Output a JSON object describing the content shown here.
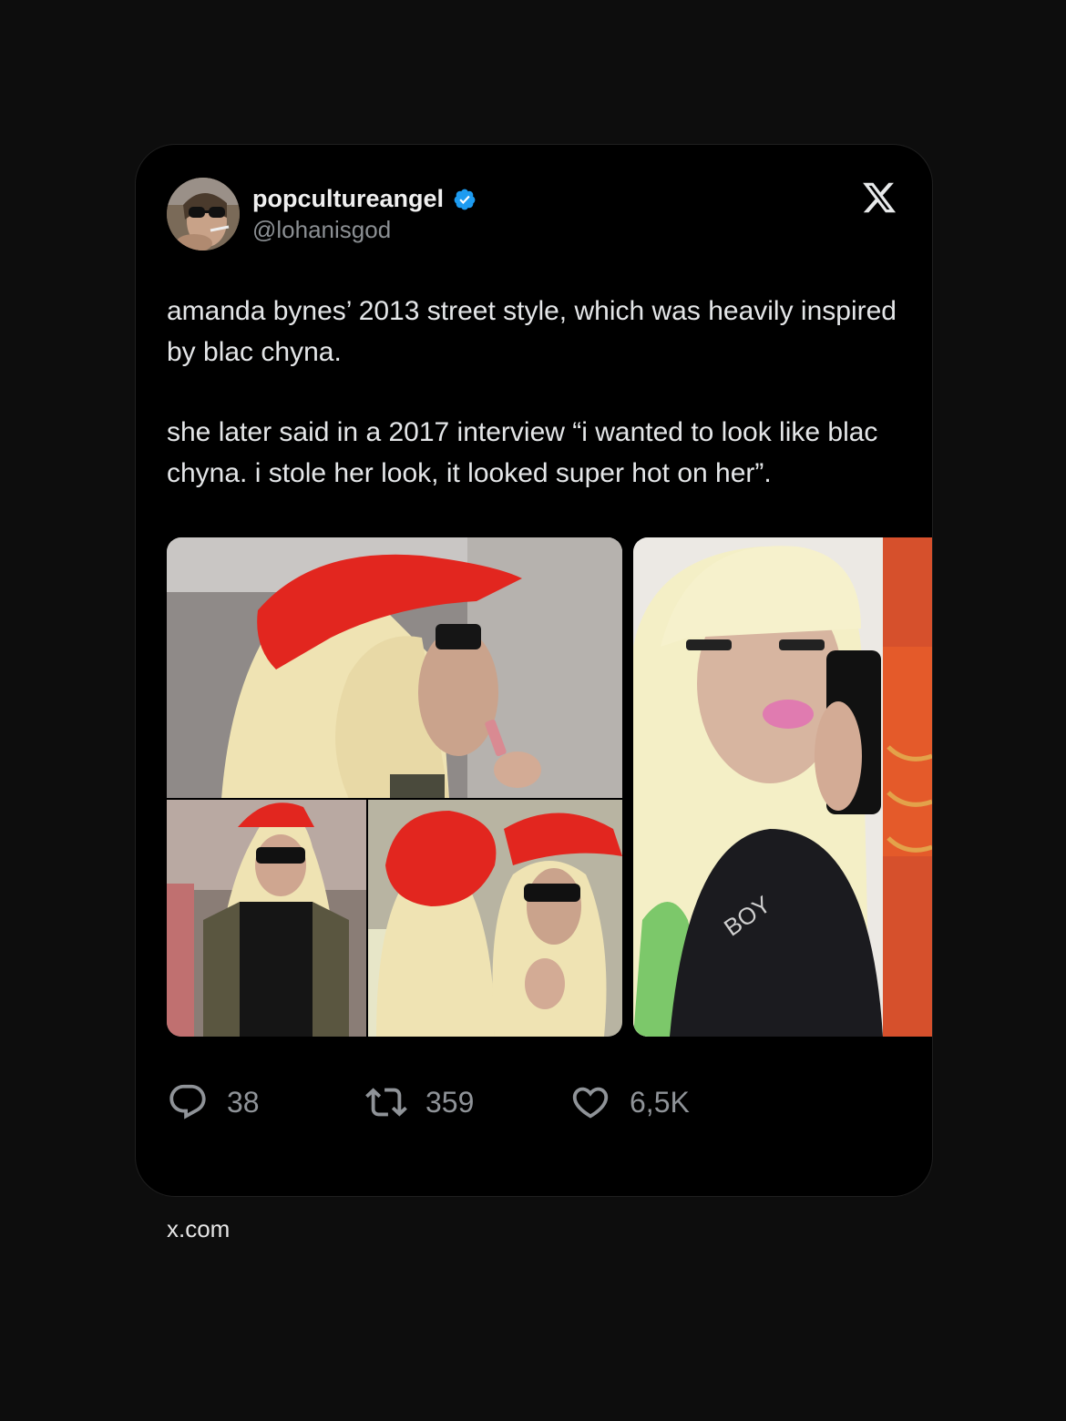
{
  "post": {
    "display_name": "popcultureangel",
    "handle": "@lohanisgod",
    "verified": true,
    "platform_icon": "x-logo-icon",
    "text_paragraphs": [
      "amanda bynes’ 2013 street style, which was heavily inspired by blac chyna.",
      "she later said in a 2017 interview “i wanted to look like blac chyna. i stole her look, it looked super hot on her”."
    ],
    "metrics": {
      "replies": "38",
      "reposts": "359",
      "likes": "6,5K"
    }
  },
  "footer": {
    "source": "x.com"
  },
  "colors": {
    "background": "#0d0d0d",
    "card": "#000000",
    "verified_blue": "#1d9bf0",
    "muted_text": "#8b8f93"
  }
}
